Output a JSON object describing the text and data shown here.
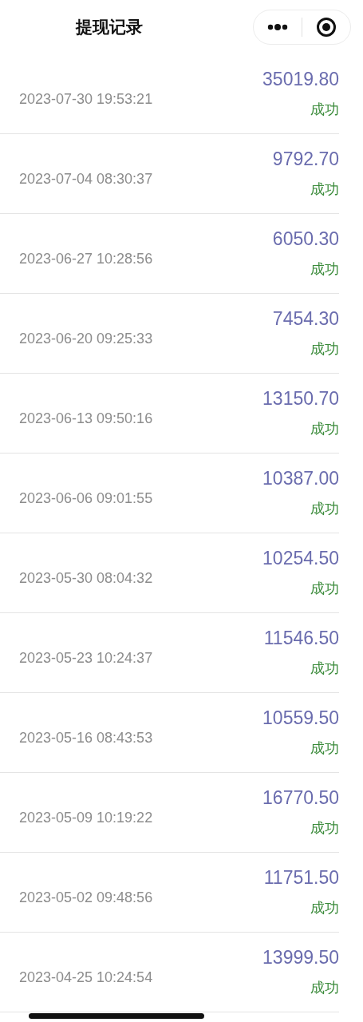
{
  "header": {
    "title": "提现记录"
  },
  "records": [
    {
      "time": "2023-07-30 19:53:21",
      "amount": "35019.80",
      "status": "成功"
    },
    {
      "time": "2023-07-04 08:30:37",
      "amount": "9792.70",
      "status": "成功"
    },
    {
      "time": "2023-06-27 10:28:56",
      "amount": "6050.30",
      "status": "成功"
    },
    {
      "time": "2023-06-20 09:25:33",
      "amount": "7454.30",
      "status": "成功"
    },
    {
      "time": "2023-06-13 09:50:16",
      "amount": "13150.70",
      "status": "成功"
    },
    {
      "time": "2023-06-06 09:01:55",
      "amount": "10387.00",
      "status": "成功"
    },
    {
      "time": "2023-05-30 08:04:32",
      "amount": "10254.50",
      "status": "成功"
    },
    {
      "time": "2023-05-23 10:24:37",
      "amount": "11546.50",
      "status": "成功"
    },
    {
      "time": "2023-05-16 08:43:53",
      "amount": "10559.50",
      "status": "成功"
    },
    {
      "time": "2023-05-09 10:19:22",
      "amount": "16770.50",
      "status": "成功"
    },
    {
      "time": "2023-05-02 09:48:56",
      "amount": "11751.50",
      "status": "成功"
    },
    {
      "time": "2023-04-25 10:24:54",
      "amount": "13999.50",
      "status": "成功"
    }
  ]
}
